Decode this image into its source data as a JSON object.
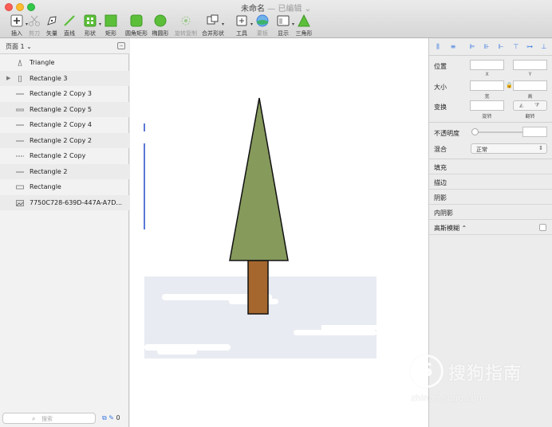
{
  "window": {
    "title": "未命名",
    "edited": "— 已编辑 ⌄"
  },
  "toolbar": {
    "insert": "插入",
    "scissors": "剪刀",
    "vector": "矢量",
    "line": "直线",
    "shape": "形状",
    "rectangle": "矩形",
    "rounded_rect": "圆角矩形",
    "oval": "椭圆形",
    "rotate_copy": "旋转复制",
    "combine": "合并形状",
    "tools": "工具",
    "mask": "蒙板",
    "display": "显示",
    "triangle": "三角形"
  },
  "left_panel": {
    "page": "页面 1 ⌄",
    "layers": [
      {
        "name": "Triangle",
        "icon": "triangle-layer-icon"
      },
      {
        "name": "Rectangle 3",
        "icon": "rect-vertical-layer-icon",
        "expandable": true
      },
      {
        "name": "Rectangle 2 Copy 3",
        "icon": "line-layer-icon"
      },
      {
        "name": "Rectangle 2 Copy 5",
        "icon": "rect-thin-layer-icon"
      },
      {
        "name": "Rectangle 2 Copy 4",
        "icon": "line-layer-icon"
      },
      {
        "name": "Rectangle 2 Copy 2",
        "icon": "line-layer-icon"
      },
      {
        "name": "Rectangle 2 Copy",
        "icon": "dash-layer-icon"
      },
      {
        "name": "Rectangle 2",
        "icon": "line-layer-icon"
      },
      {
        "name": "Rectangle",
        "icon": "rect-layer-icon"
      },
      {
        "name": "7750C728-639D-447A-A7D...",
        "icon": "image-layer-icon"
      }
    ],
    "search_placeholder": "搜索",
    "bottom_count": "0"
  },
  "inspector": {
    "position": "位置",
    "x": "X",
    "y": "Y",
    "size": "大小",
    "width": "宽",
    "height": "高",
    "transform": "变换",
    "rotate": "旋转",
    "flip": "翻转",
    "opacity": "不透明度",
    "blend": "混合",
    "blend_value": "正常",
    "fill": "填充",
    "border": "描边",
    "shadow": "阴影",
    "inner_shadow": "内阴影",
    "gaussian_blur": "高斯模糊 ⌃"
  },
  "colors": {
    "tree_foliage": "#869a5c",
    "tree_trunk": "#a5672e",
    "snow_block": "#e9ebf2",
    "selection_line": "#5b78d6",
    "accent": "#3d7be0",
    "tool_green": "#5cbf3a"
  },
  "watermark": {
    "brand": "搜狗指南",
    "url": "zhinan.sogo.com",
    "logo_letter": "S"
  }
}
